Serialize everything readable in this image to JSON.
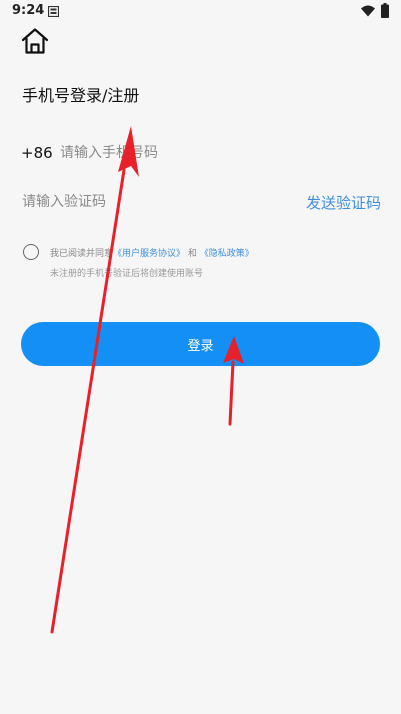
{
  "status_bar": {
    "time": "9:24",
    "icons": [
      "notification-icon",
      "wifi-icon",
      "battery-icon"
    ]
  },
  "header": {
    "home_icon": "home-icon"
  },
  "page": {
    "title": "手机号登录/注册"
  },
  "phone": {
    "country_code": "+86",
    "placeholder": "请输入手机号码",
    "value": ""
  },
  "verification": {
    "placeholder": "请输入验证码",
    "value": "",
    "send_code_label": "发送验证码"
  },
  "agreement": {
    "checked": false,
    "prefix": "我已阅读并同意",
    "user_agreement": "《用户服务协议》",
    "and": "和",
    "privacy_policy": "《隐私政策》",
    "note": "未注册的手机号验证后将创建使用账号"
  },
  "login_button": {
    "label": "登录"
  },
  "colors": {
    "background": "#f6f6f6",
    "primary": "#148ff5",
    "link": "#3f8fe0",
    "annotation_arrow": "#e8202a"
  }
}
